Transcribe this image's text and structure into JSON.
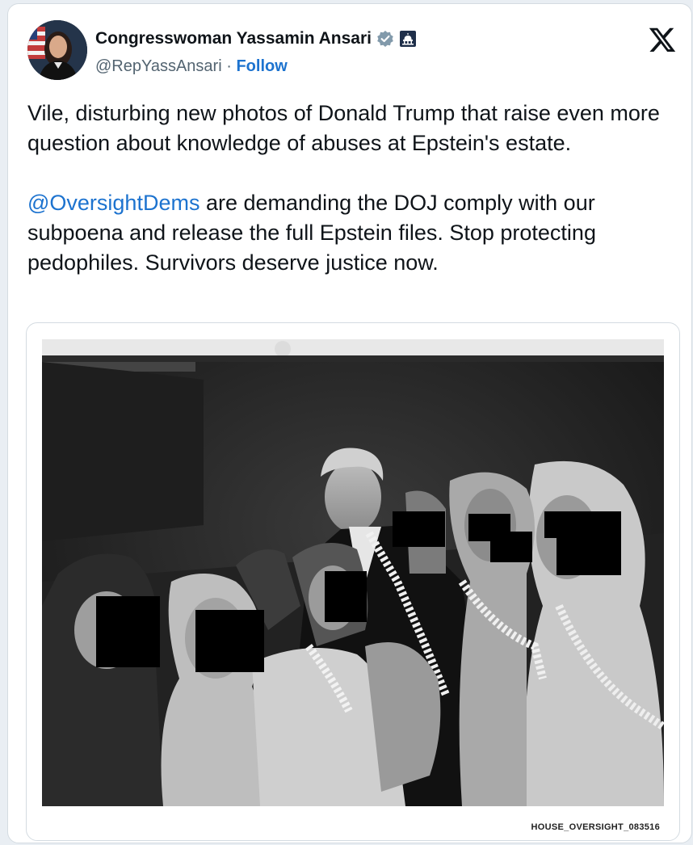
{
  "author": {
    "name": "Congresswoman Yassamin Ansari",
    "handle": "@RepYassAnsari",
    "separator": " · ",
    "follow_label": "Follow",
    "verified_icon": "verified-badge-icon",
    "affiliation_icon": "capitol-icon"
  },
  "platform_icon": "x-logo-icon",
  "tweet": {
    "paragraph1": "Vile, disturbing new photos of Donald Trump that raise even more question about knowledge of abuses at Epstein's estate.",
    "mention": "@OversightDems",
    "paragraph2_rest": " are demanding the DOJ comply with our subpoena and release the full Epstein files. Stop protecting pedophiles. Survivors deserve justice now."
  },
  "media": {
    "caption": "HOUSE_OVERSIGHT_083516"
  },
  "colors": {
    "link": "#1d73cf",
    "text": "#0f1419",
    "muted": "#536471",
    "verified": "#829aab"
  }
}
